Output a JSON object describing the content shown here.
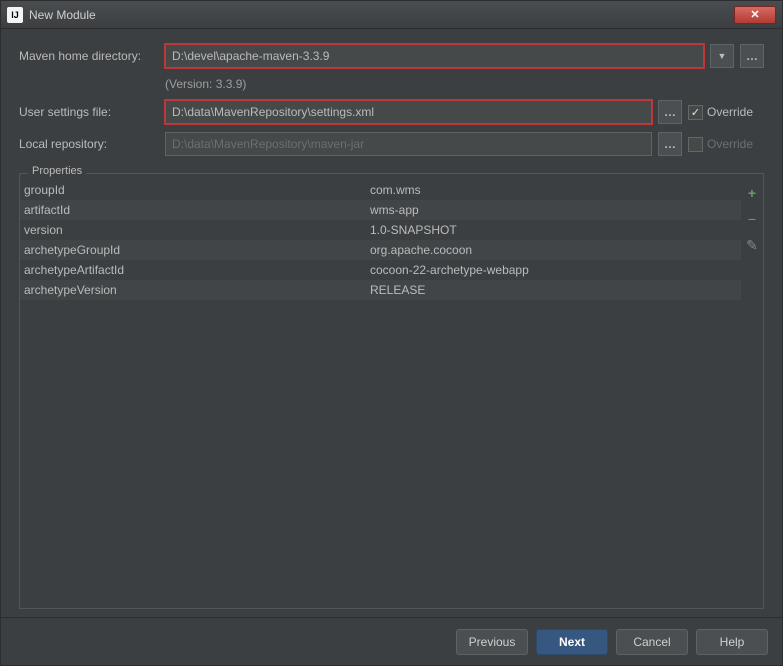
{
  "window": {
    "title": "New Module"
  },
  "labels": {
    "maven_home": "Maven home directory:",
    "user_settings": "User settings file:",
    "local_repo": "Local repository:",
    "version_info": "(Version: 3.3.9)",
    "override": "Override"
  },
  "fields": {
    "maven_home_path": "D:\\devel\\apache-maven-3.3.9",
    "user_settings_path": "D:\\data\\MavenRepository\\settings.xml",
    "local_repo_path": "D:\\data\\MavenRepository\\maven-jar"
  },
  "panel": {
    "title": "Properties"
  },
  "properties": [
    {
      "key": "groupId",
      "value": "com.wms"
    },
    {
      "key": "artifactId",
      "value": "wms-app"
    },
    {
      "key": "version",
      "value": "1.0-SNAPSHOT"
    },
    {
      "key": "archetypeGroupId",
      "value": "org.apache.cocoon"
    },
    {
      "key": "archetypeArtifactId",
      "value": "cocoon-22-archetype-webapp"
    },
    {
      "key": "archetypeVersion",
      "value": "RELEASE"
    }
  ],
  "buttons": {
    "previous": "Previous",
    "next": "Next",
    "cancel": "Cancel",
    "help": "Help",
    "ellipsis": "…"
  },
  "icons": {
    "dropdown": "▼",
    "plus": "+",
    "minus": "−",
    "edit": "✎",
    "close": "✕"
  }
}
